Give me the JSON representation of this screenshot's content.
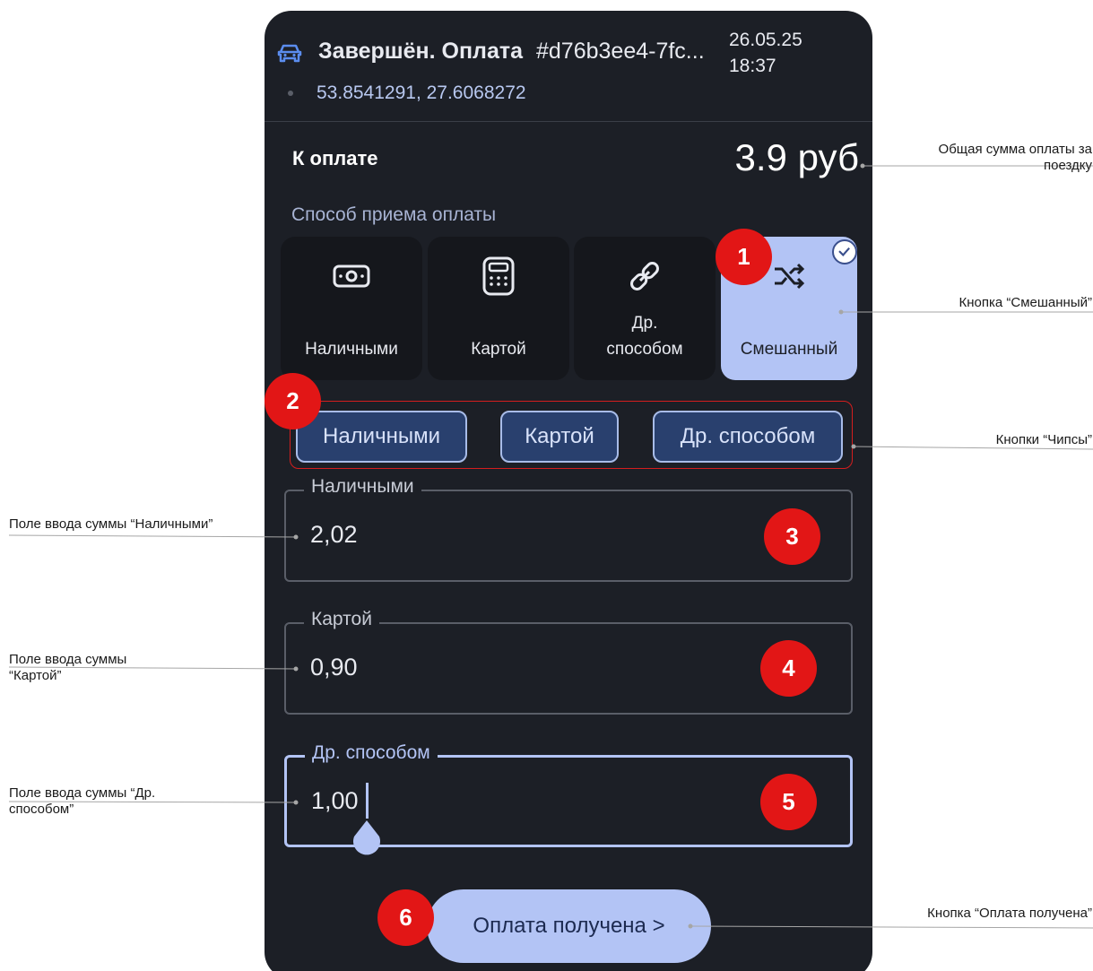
{
  "header": {
    "status": "Завершён. Оплата",
    "order_id": "#d76b3ee4-7fc...",
    "date": "26.05.25",
    "time": "18:37",
    "coordinates": "53.8541291, 27.6068272"
  },
  "payment": {
    "label": "К оплате",
    "amount": "3.9 руб"
  },
  "methods": {
    "title": "Способ приема оплаты",
    "items": [
      {
        "label": "Наличными",
        "icon": "cash-icon"
      },
      {
        "label": "Картой",
        "icon": "calculator-icon"
      },
      {
        "label_line1": "Др.",
        "label_line2": "способом",
        "icon": "link-icon"
      },
      {
        "label": "Смешанный",
        "icon": "shuffle-icon",
        "selected": true
      }
    ]
  },
  "chips": [
    "Наличными",
    "Картой",
    "Др. способом"
  ],
  "fields": [
    {
      "label": "Наличными",
      "value": "2,02"
    },
    {
      "label": "Картой",
      "value": "0,90"
    },
    {
      "label": "Др. способом",
      "value": "1,00"
    }
  ],
  "paid_button": "Оплата получена >",
  "markers": [
    "1",
    "2",
    "3",
    "4",
    "5",
    "6"
  ],
  "annotations": {
    "total": "Общая сумма оплаты за поездку",
    "mixed_button": "Кнопка “Смешанный”",
    "chips": "Кнопки “Чипсы”",
    "cash_field": "Поле ввода суммы “Наличными”",
    "card_field": "Поле ввода суммы “Картой”",
    "other_field": "Поле ввода суммы “Др. способом”",
    "paid_button": "Кнопка “Оплата получена”"
  },
  "colors": {
    "background": "#1c1f26",
    "accent": "#b3c4f5",
    "chip": "#29406e",
    "marker": "#e21616"
  }
}
